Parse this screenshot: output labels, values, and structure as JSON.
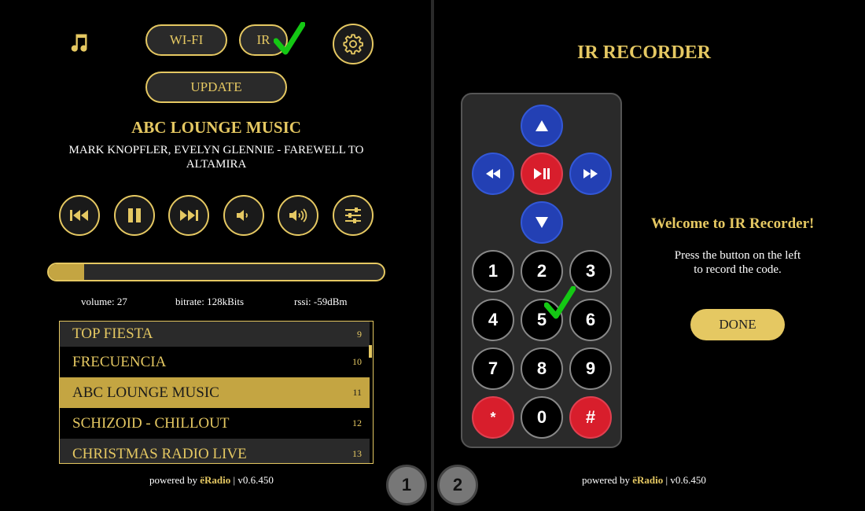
{
  "header": {
    "wifi_label": "WI-FI",
    "ir_label": "IR",
    "update_label": "UPDATE"
  },
  "now_playing": {
    "station": "ABC LOUNGE MUSIC",
    "track": "MARK KNOPFLER, EVELYN GLENNIE - FAREWELL TO ALTAMIRA"
  },
  "volume_bar": {
    "fraction": 0.105
  },
  "stats": {
    "volume": "volume: 27",
    "bitrate": "bitrate: 128kBits",
    "rssi": "rssi: -59dBm"
  },
  "playlist": [
    {
      "name": "TOP FIESTA",
      "num": "9"
    },
    {
      "name": "FRECUENCIA",
      "num": "10"
    },
    {
      "name": "ABC LOUNGE MUSIC",
      "num": "11"
    },
    {
      "name": "SCHIZOID - CHILLOUT",
      "num": "12"
    },
    {
      "name": "CHRISTMAS RADIO LIVE",
      "num": "13"
    }
  ],
  "footer": {
    "prefix": "powered by ",
    "brand": "ёRadio",
    "version": " | v0.6.450"
  },
  "pages": {
    "p1": "1",
    "p2": "2"
  },
  "ir": {
    "title": "IR RECORDER",
    "welcome": "Welcome to IR Recorder!",
    "instruction_line1": "Press the button on the left",
    "instruction_line2": "to record the code.",
    "done_label": "DONE",
    "keys": {
      "k1": "1",
      "k2": "2",
      "k3": "3",
      "k4": "4",
      "k5": "5",
      "k6": "6",
      "k7": "7",
      "k8": "8",
      "k9": "9",
      "star": "*",
      "k0": "0",
      "hash": "#"
    }
  },
  "colors": {
    "accent": "#e5c862",
    "active_row": "#c4a542",
    "remote_blue": "#2340b4",
    "remote_red": "#d81e2c",
    "check_green": "#14c814"
  },
  "icons": [
    "music-note-icon",
    "gear-icon",
    "prev-icon",
    "pause-icon",
    "next-icon",
    "volume-down-icon",
    "volume-up-icon",
    "equalizer-icon",
    "check-icon",
    "arrow-up-icon",
    "arrow-down-icon",
    "rewind-icon",
    "play-pause-icon",
    "fast-forward-icon"
  ]
}
